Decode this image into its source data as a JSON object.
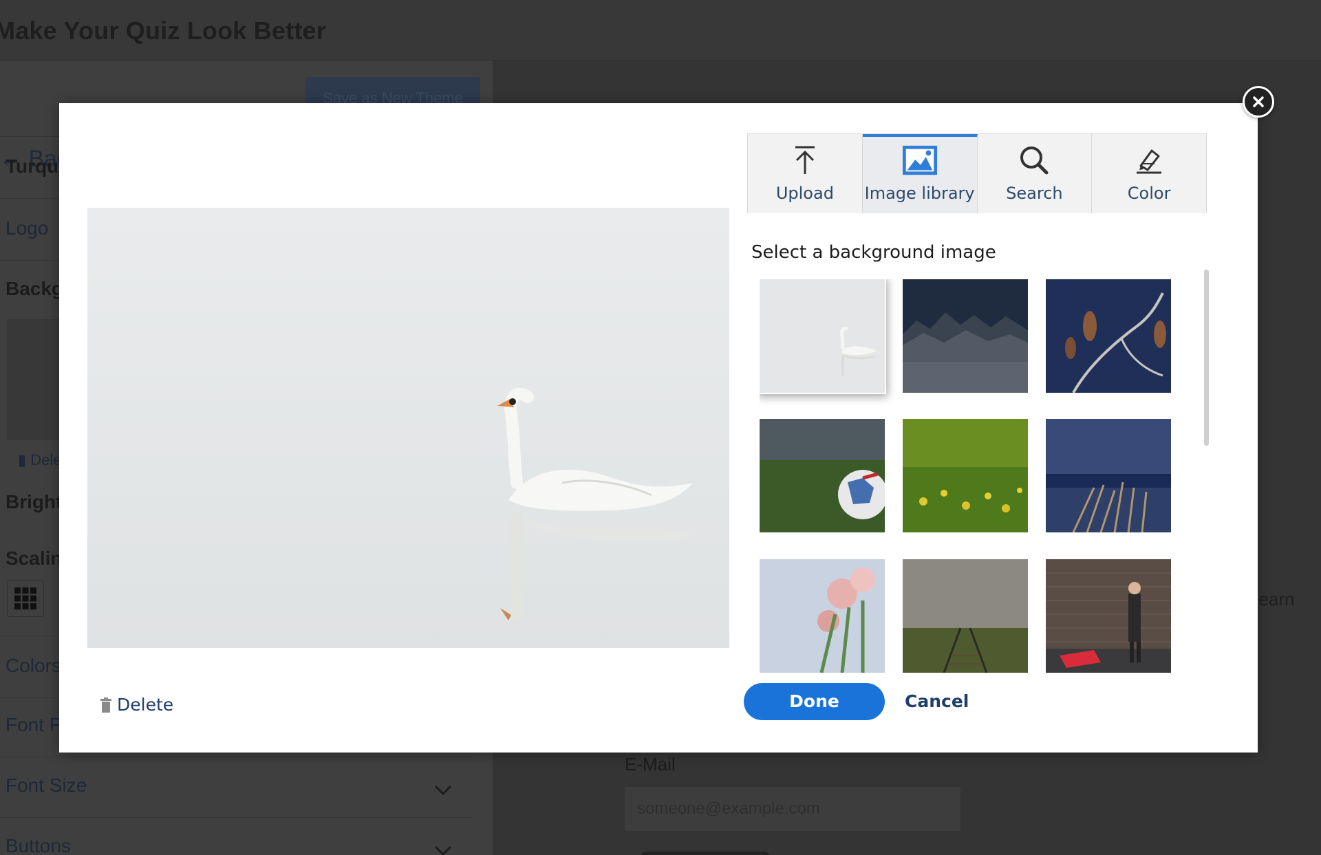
{
  "app": {
    "title": "Make Your Quiz Look Better"
  },
  "sidebar": {
    "back_label": "Back to Theme",
    "save_button": "Save as New Theme",
    "theme_name": "Turquoise",
    "logo_label": "Logo",
    "background_label": "Background",
    "delete_label": "Delete",
    "brightness_label": "Brightness",
    "scaling_label": "Scaling",
    "colors_label": "Colors",
    "font_family_label": "Font Family",
    "font_size_label": "Font Size",
    "buttons_label": "Buttons"
  },
  "main": {
    "email_label": "E-Mail",
    "email_placeholder": "someone@example.com",
    "learn_text": "Learn"
  },
  "modal": {
    "tabs": [
      {
        "label": "Upload",
        "icon": "upload-icon",
        "active": false
      },
      {
        "label": "Image library",
        "icon": "image-icon",
        "active": true
      },
      {
        "label": "Search",
        "icon": "search-icon",
        "active": false
      },
      {
        "label": "Color",
        "icon": "paint-bucket-icon",
        "active": false
      }
    ],
    "library_heading": "Select a background image",
    "thumbnails": [
      {
        "subject": "swan on water",
        "selected": true
      },
      {
        "subject": "snowy mountains",
        "selected": false
      },
      {
        "subject": "frosted branch buds",
        "selected": false
      },
      {
        "subject": "soccer ball on grass",
        "selected": false
      },
      {
        "subject": "yellow wildflowers",
        "selected": false
      },
      {
        "subject": "grass by the sea",
        "selected": false
      },
      {
        "subject": "pink flowers bouquet",
        "selected": false
      },
      {
        "subject": "railway tracks in fog",
        "selected": false
      },
      {
        "subject": "musician by brick wall",
        "selected": false
      }
    ],
    "delete_label": "Delete",
    "done_label": "Done",
    "cancel_label": "Cancel"
  },
  "colors": {
    "accent": "#1a73d9",
    "link": "#1f3f6a",
    "tab_active_border": "#2f7fd8"
  }
}
